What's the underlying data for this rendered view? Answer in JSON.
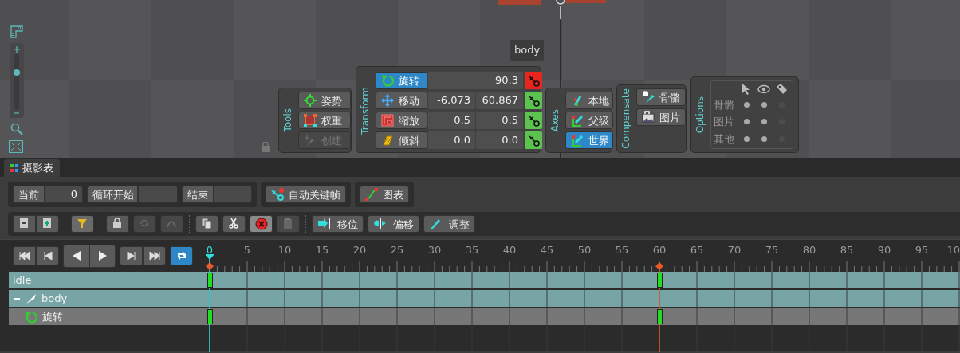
{
  "viewport": {
    "bone_label": "body",
    "zoom": {
      "level": 0.7
    }
  },
  "tools": {
    "title": "Tools",
    "items": [
      {
        "label": "姿势",
        "disabled": false
      },
      {
        "label": "权重",
        "disabled": false
      },
      {
        "label": "创建",
        "disabled": true
      }
    ]
  },
  "transform": {
    "title": "Transform",
    "rows": [
      {
        "label": "旋转",
        "selected": true,
        "values": [
          "90.3"
        ],
        "changed": true
      },
      {
        "label": "移动",
        "selected": false,
        "values": [
          "-6.073",
          "60.867"
        ],
        "changed": false
      },
      {
        "label": "缩放",
        "selected": false,
        "values": [
          "0.5",
          "0.5"
        ],
        "changed": false
      },
      {
        "label": "倾斜",
        "selected": false,
        "values": [
          "0.0",
          "0.0"
        ],
        "changed": false
      }
    ]
  },
  "axes": {
    "title": "Axes",
    "items": [
      {
        "label": "本地",
        "selected": false
      },
      {
        "label": "父级",
        "selected": false
      },
      {
        "label": "世界",
        "selected": true
      }
    ]
  },
  "compensate": {
    "title": "Compensate",
    "items": [
      {
        "label": "骨骼"
      },
      {
        "label": "图片"
      }
    ]
  },
  "options": {
    "title": "Options",
    "rows": [
      {
        "label": "骨骼",
        "flags": [
          true,
          true,
          false
        ]
      },
      {
        "label": "图片",
        "flags": [
          true,
          true,
          false
        ]
      },
      {
        "label": "其他",
        "flags": [
          true,
          true,
          false
        ]
      }
    ]
  },
  "dopesheet": {
    "tab": "摄影表",
    "fields": [
      {
        "label": "当前",
        "value": "0"
      },
      {
        "label": "循环开始"
      },
      {
        "label": "结束"
      }
    ],
    "auto_key": {
      "label": "自动关键帧"
    },
    "graph": {
      "label": "图表"
    },
    "icon_buttons": [
      {
        "disabled": false
      },
      {
        "disabled": false
      },
      {
        "disabled": false
      },
      {
        "disabled": false
      },
      {
        "disabled": true
      },
      {
        "disabled": true
      },
      {
        "disabled": false
      },
      {
        "disabled": false
      },
      {
        "disabled": false
      },
      {
        "disabled": true
      }
    ],
    "text_buttons": [
      {
        "label": "移位"
      },
      {
        "label": "偏移"
      },
      {
        "label": "调整"
      }
    ],
    "loop": {
      "selected": true
    }
  },
  "timeline": {
    "ticks": [
      {
        "label": "0",
        "playhead": true,
        "end": false,
        "keyframe": true
      },
      {
        "label": "5",
        "playhead": false,
        "end": false,
        "keyframe": false
      },
      {
        "label": "10",
        "playhead": false,
        "end": false,
        "keyframe": false
      },
      {
        "label": "15",
        "playhead": false,
        "end": false,
        "keyframe": false
      },
      {
        "label": "20",
        "playhead": false,
        "end": false,
        "keyframe": false
      },
      {
        "label": "25",
        "playhead": false,
        "end": false,
        "keyframe": false
      },
      {
        "label": "30",
        "playhead": false,
        "end": false,
        "keyframe": false
      },
      {
        "label": "35",
        "playhead": false,
        "end": false,
        "keyframe": false
      },
      {
        "label": "40",
        "playhead": false,
        "end": false,
        "keyframe": false
      },
      {
        "label": "45",
        "playhead": false,
        "end": false,
        "keyframe": false
      },
      {
        "label": "50",
        "playhead": false,
        "end": false,
        "keyframe": false
      },
      {
        "label": "55",
        "playhead": false,
        "end": false,
        "keyframe": false
      },
      {
        "label": "60",
        "playhead": false,
        "end": true,
        "keyframe": true
      },
      {
        "label": "65",
        "playhead": false,
        "end": false,
        "keyframe": false
      },
      {
        "label": "70",
        "playhead": false,
        "end": false,
        "keyframe": false
      },
      {
        "label": "75",
        "playhead": false,
        "end": false,
        "keyframe": false
      },
      {
        "label": "80",
        "playhead": false,
        "end": false,
        "keyframe": false
      },
      {
        "label": "85",
        "playhead": false,
        "end": false,
        "keyframe": false
      },
      {
        "label": "90",
        "playhead": false,
        "end": false,
        "keyframe": false
      },
      {
        "label": "95",
        "playhead": false,
        "end": false,
        "keyframe": false
      },
      {
        "label": "10",
        "playhead": false,
        "end": false,
        "keyframe": false
      }
    ],
    "tracks": [
      {
        "name": "idle",
        "kind": "animation",
        "has_keys": true
      },
      {
        "name": "body",
        "kind": "bone",
        "expanded": true,
        "has_keys": false
      },
      {
        "name": "旋转",
        "kind": "timeline",
        "has_keys": true
      }
    ]
  }
}
